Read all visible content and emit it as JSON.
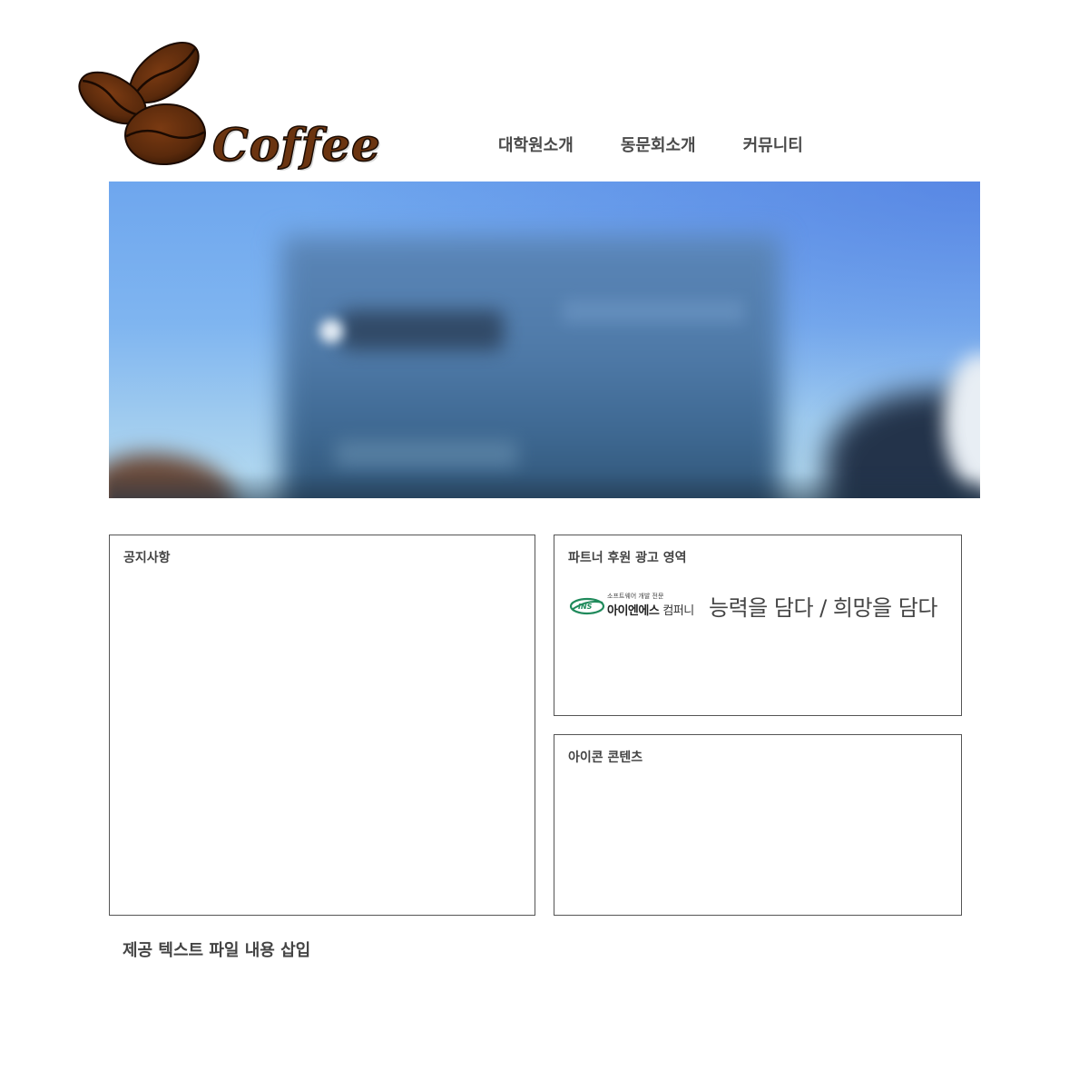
{
  "header": {
    "logo_text": "Coffee",
    "nav": [
      {
        "label": "대학원소개"
      },
      {
        "label": "동문회소개"
      },
      {
        "label": "커뮤니티"
      }
    ]
  },
  "notice": {
    "title": "공지사항"
  },
  "partner": {
    "title": "파트너 후원 광고 영역",
    "ad": {
      "logo_mark": "INS",
      "tagline_small": "소프트웨어 개발 전문",
      "company_bold": "아이엔에스",
      "company_thin": "컴퍼니",
      "slogan": "능력을 담다 / 희망을 담다",
      "brand_color": "#1f8a5b"
    }
  },
  "icons_section": {
    "title": "아이콘 콘텐츠"
  },
  "footer": {
    "text": "제공 텍스트 파일 내용 삽입"
  },
  "colors": {
    "text": "#444444",
    "border": "#555555",
    "logo_brown": "#5a2a0c"
  }
}
